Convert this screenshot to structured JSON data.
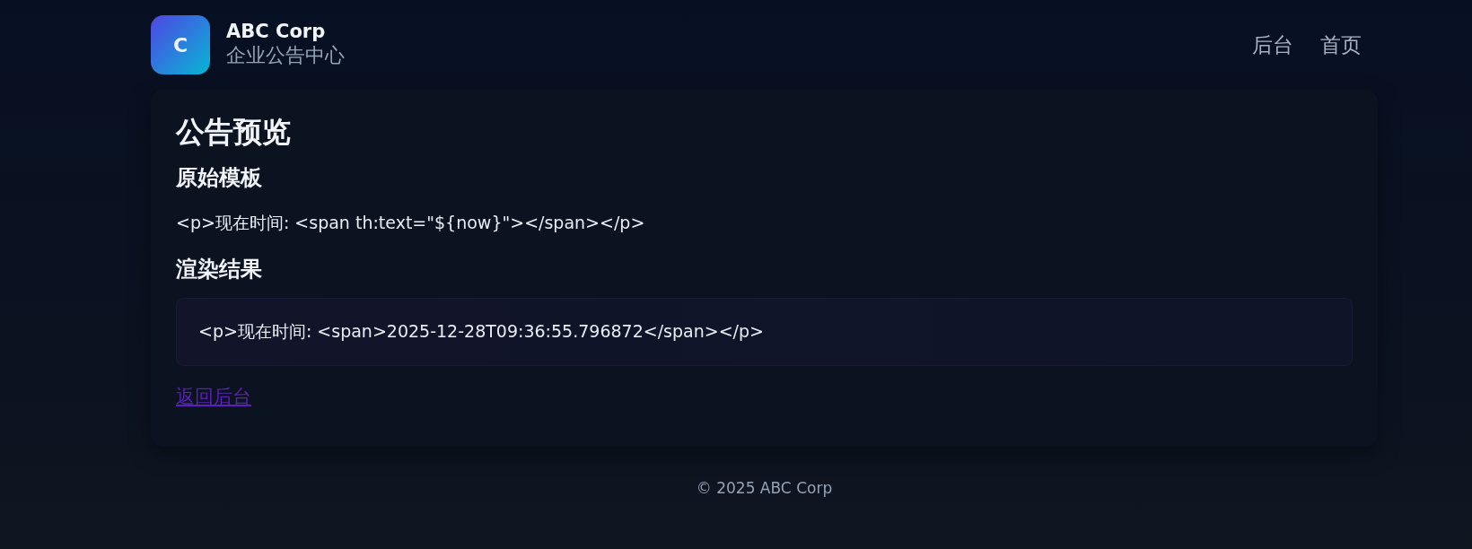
{
  "header": {
    "logo_letter": "C",
    "brand": "ABC Corp",
    "subtitle": "企业公告中心",
    "nav": [
      {
        "label": "后台"
      },
      {
        "label": "首页"
      }
    ]
  },
  "card": {
    "title": "公告预览",
    "template_heading": "原始模板",
    "template_code": "<p>现在时间: <span th:text=\"${now}\"></span></p>",
    "result_heading": "渲染结果",
    "result_output": "<p>现在时间: <span>2025-12-28T09:36:55.796872</span></p>",
    "back_link": "返回后台"
  },
  "footer": {
    "copyright": "© 2025 ABC Corp"
  }
}
